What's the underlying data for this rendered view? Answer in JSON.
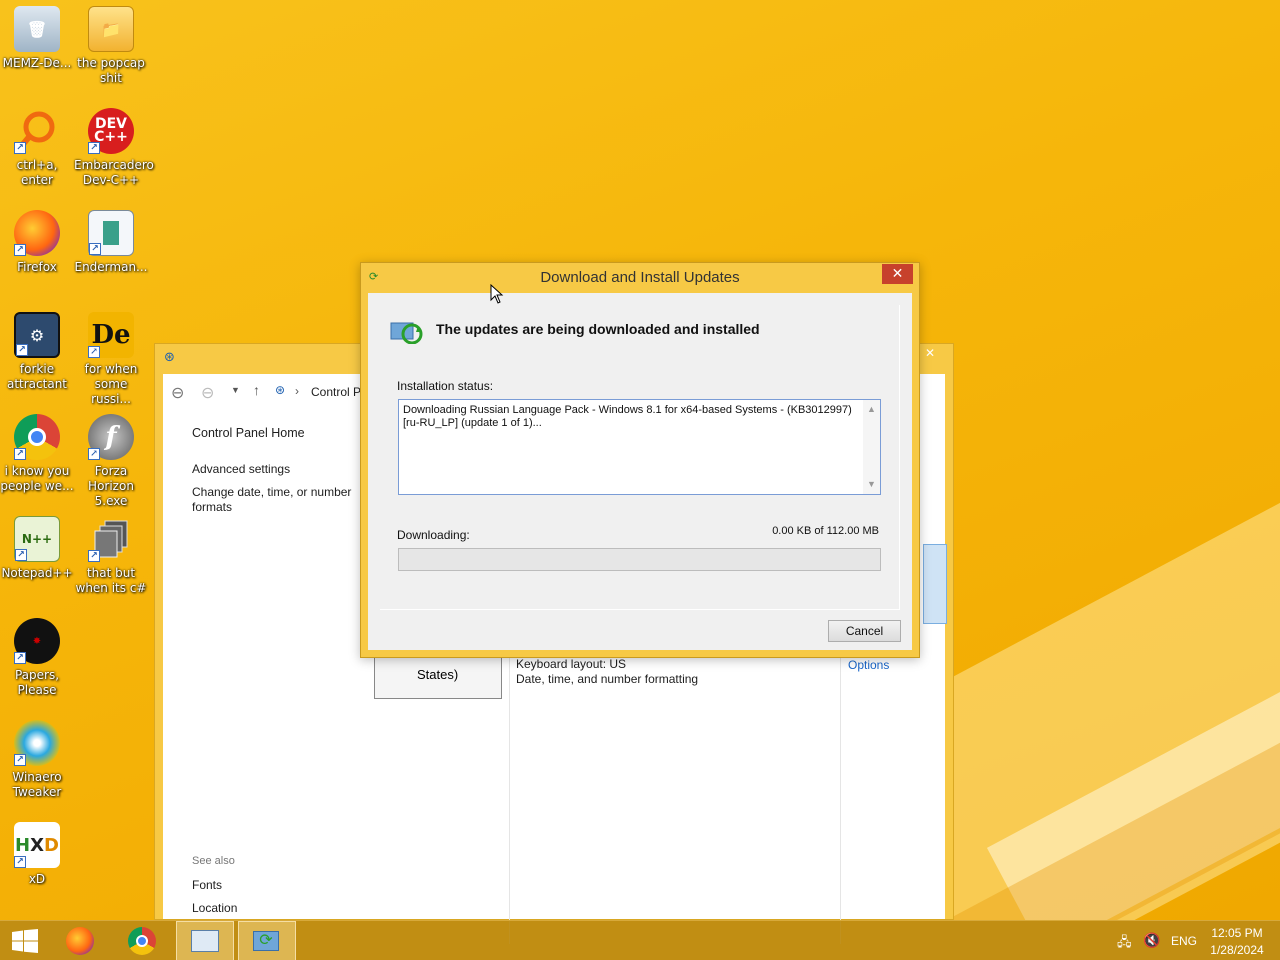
{
  "desktop_icons": [
    {
      "label": "MEMZ-De...",
      "icon": "recycle-bin-icon"
    },
    {
      "label": "the popcap shit",
      "icon": "folder-icon"
    },
    {
      "label": "ctrl+a, enter",
      "icon": "magnifier-icon"
    },
    {
      "label": "Embarcadero Dev-C++",
      "icon": "devcpp-icon"
    },
    {
      "label": "Firefox",
      "icon": "firefox-icon"
    },
    {
      "label": "Enderman...",
      "icon": "window-app-icon"
    },
    {
      "label": "forkie attractant",
      "icon": "settings-monitor-icon"
    },
    {
      "label": "for when some russi...",
      "icon": "de-app-icon"
    },
    {
      "label": "i know you people we...",
      "icon": "chrome-icon"
    },
    {
      "label": "Forza Horizon 5.exe",
      "icon": "flash-icon"
    },
    {
      "label": "Notepad++",
      "icon": "notepadpp-icon"
    },
    {
      "label": "that but when its c#",
      "icon": "files-stack-icon"
    },
    {
      "label": "Papers, Please",
      "icon": "papers-please-icon"
    },
    {
      "label": "Winaero Tweaker",
      "icon": "winaero-icon"
    },
    {
      "label": "xD",
      "icon": "hxd-icon"
    }
  ],
  "control_panel": {
    "breadcrumb": "Control P",
    "sidebar": {
      "home": "Control Panel Home",
      "advanced": "Advanced settings",
      "change_date": "Change date, time, or number formats",
      "see_also": "See also",
      "fonts": "Fonts",
      "location": "Location"
    },
    "language_tile": "States)",
    "details": {
      "keyboard": "Keyboard layout: US",
      "formatting": "Date, time, and number formatting",
      "options": "Options"
    }
  },
  "dialog": {
    "title": "Download and Install Updates",
    "close_glyph": "✕",
    "headline": "The updates are being downloaded and installed",
    "status_label": "Installation status:",
    "status_text": "Downloading Russian Language Pack - Windows 8.1 for x64-based Systems - (KB3012997) [ru-RU_LP] (update 1 of 1)...",
    "downloading_label": "Downloading:",
    "downloaded": "0.00 KB of 112.00 MB",
    "progress": 0,
    "cancel_label": "Cancel"
  },
  "taskbar": {
    "items": [
      "start",
      "firefox",
      "chrome",
      "control-panel",
      "windows-update"
    ],
    "language": "ENG",
    "time": "12:05 PM",
    "date": "1/28/2024"
  },
  "colors": {
    "accent": "#f7c945",
    "close": "#c7412c",
    "desktop": "#f6b60a"
  }
}
